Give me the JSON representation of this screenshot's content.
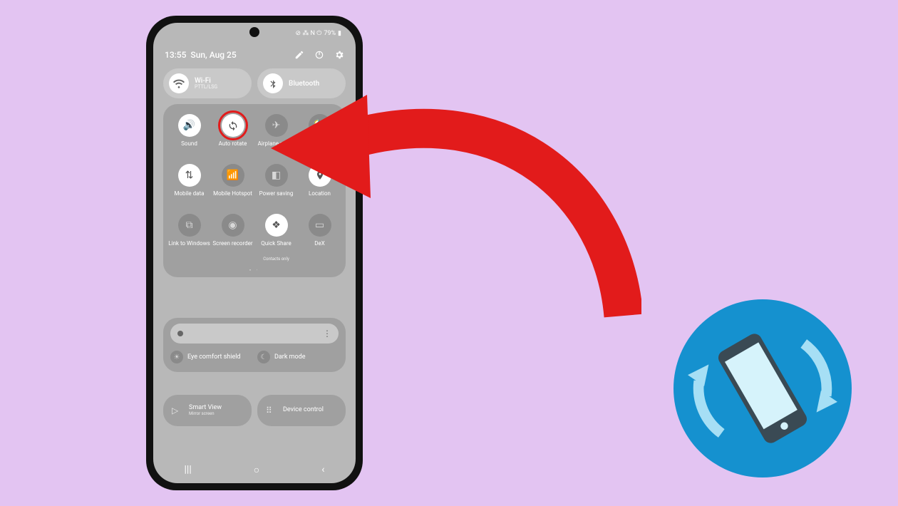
{
  "status": {
    "battery": "79%",
    "icons": "⊘ ⁂ N ⏻"
  },
  "header": {
    "time": "13:55",
    "date": "Sun, Aug 25"
  },
  "pills": {
    "wifi": {
      "title": "Wi-Fi",
      "subtitle": "PTTL/LSG"
    },
    "bluetooth": {
      "title": "Bluetooth"
    }
  },
  "tiles": {
    "sound": "Sound",
    "auto_rotate": "Auto rotate",
    "airplane": "Airplane mode",
    "flashlight": "",
    "mobile_data": "Mobile data",
    "hotspot": "Mobile Hotspot",
    "power": "Power saving",
    "location": "Location",
    "link": "Link to Windows",
    "recorder": "Screen recorder",
    "quickshare": "Quick Share",
    "quickshare_sub": "Contacts only",
    "dex": "DeX"
  },
  "toggles": {
    "eye": "Eye comfort shield",
    "dark": "Dark mode"
  },
  "bottom": {
    "smartview": {
      "title": "Smart View",
      "subtitle": "Mirror screen"
    },
    "device": {
      "title": "Device control"
    }
  }
}
